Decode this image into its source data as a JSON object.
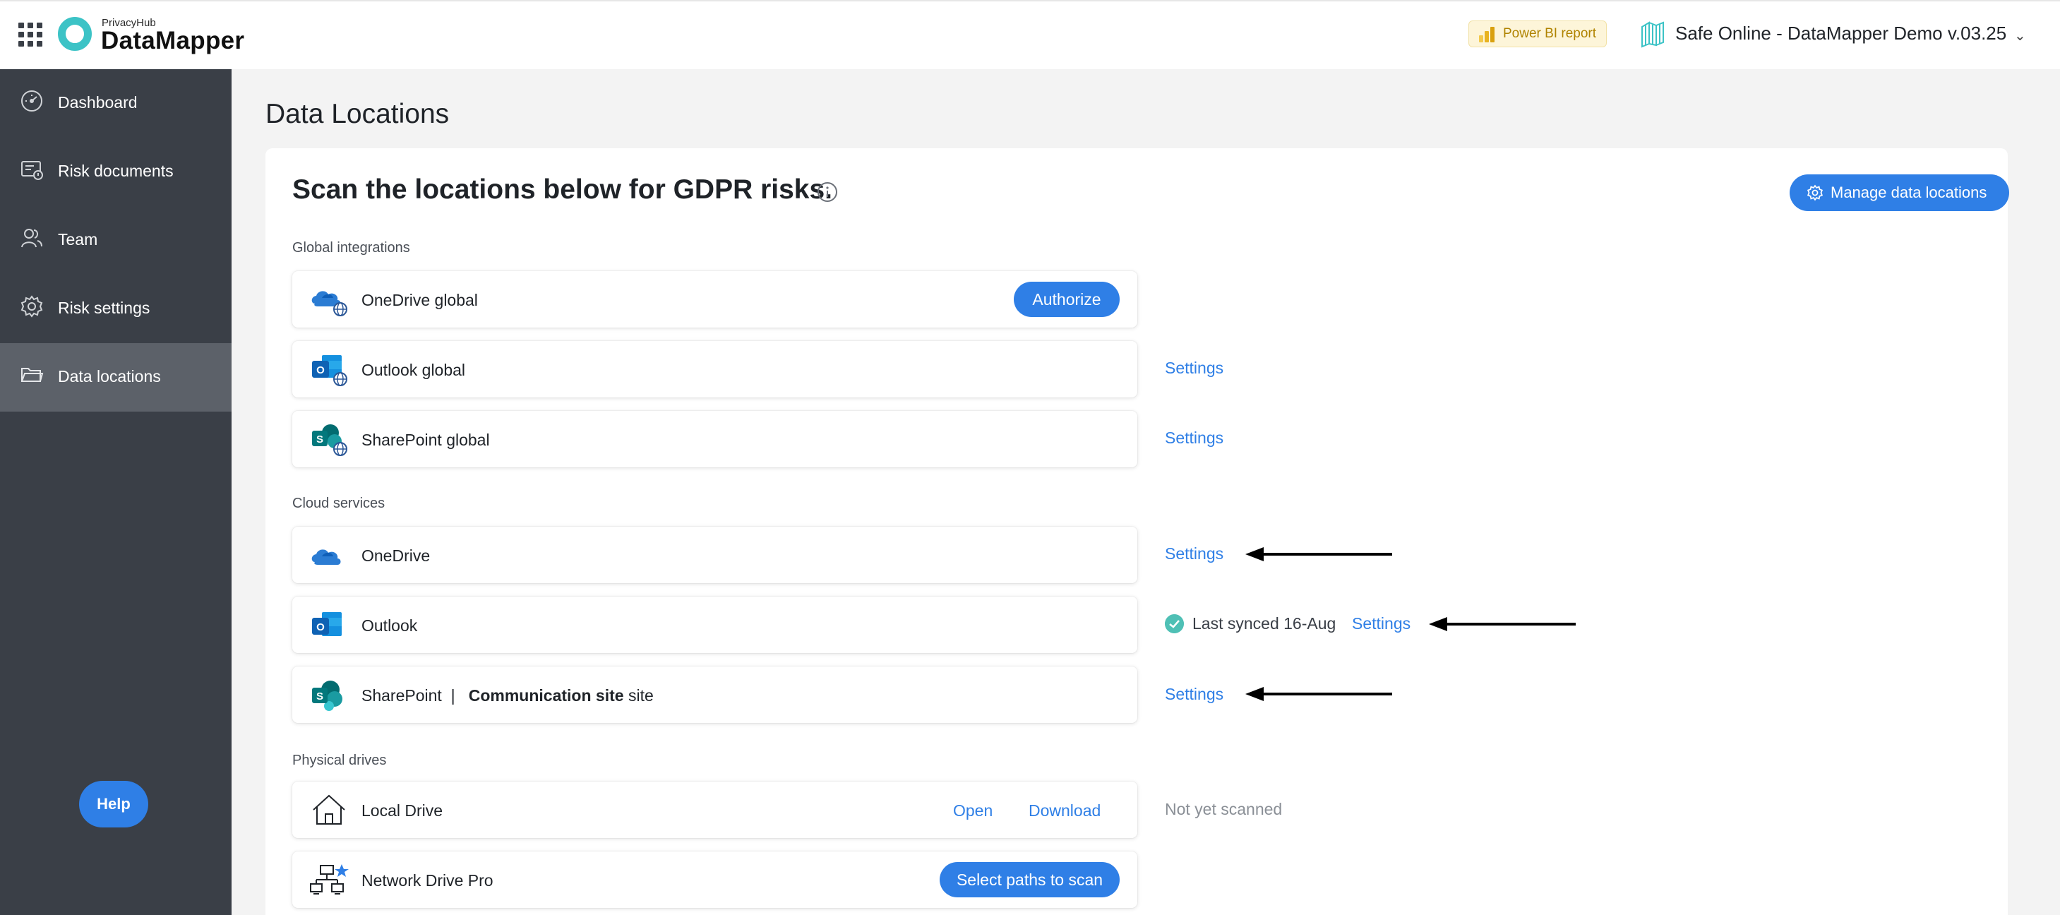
{
  "header": {
    "brand_small": "PrivacyHub",
    "brand_name": "DataMapper",
    "powerbi_label": "Power BI report",
    "tenant_label": "Safe Online - DataMapper Demo v.03.25",
    "tenant_chevron": "⌄"
  },
  "sidebar": {
    "items": [
      {
        "label": "Dashboard",
        "icon": "gauge-icon"
      },
      {
        "label": "Risk documents",
        "icon": "risk-document-icon"
      },
      {
        "label": "Team",
        "icon": "team-icon"
      },
      {
        "label": "Risk settings",
        "icon": "gear-icon"
      },
      {
        "label": "Data locations",
        "icon": "folder-icon",
        "active": true
      }
    ],
    "help_label": "Help"
  },
  "main": {
    "page_title": "Data Locations",
    "card_title": "Scan the locations below for GDPR risks.",
    "manage_label": "Manage data locations",
    "sections": {
      "global": "Global integrations",
      "cloud": "Cloud services",
      "physical": "Physical drives"
    },
    "rows": {
      "onedrive_global": {
        "label": "OneDrive global",
        "action": "Authorize"
      },
      "outlook_global": {
        "label": "Outlook global",
        "settings": "Settings"
      },
      "sharepoint_global": {
        "label": "SharePoint global",
        "settings": "Settings"
      },
      "onedrive": {
        "label": "OneDrive",
        "settings": "Settings"
      },
      "outlook": {
        "label": "Outlook",
        "sync_status": "Last synced 16-Aug",
        "settings": "Settings"
      },
      "sharepoint": {
        "label": "SharePoint",
        "separator": "|",
        "site_name": "Communication site",
        "site_suffix": "site",
        "settings": "Settings"
      },
      "local_drive": {
        "label": "Local Drive",
        "open": "Open",
        "download": "Download",
        "status": "Not yet scanned"
      },
      "network_drive": {
        "label": "Network Drive Pro",
        "action": "Select paths to scan"
      }
    }
  },
  "colors": {
    "accent": "#2f7fe6",
    "sidebar": "#3a3f47",
    "sidebar_active": "#5c6169",
    "teal": "#3cc3c6",
    "success": "#4fc0b5"
  }
}
